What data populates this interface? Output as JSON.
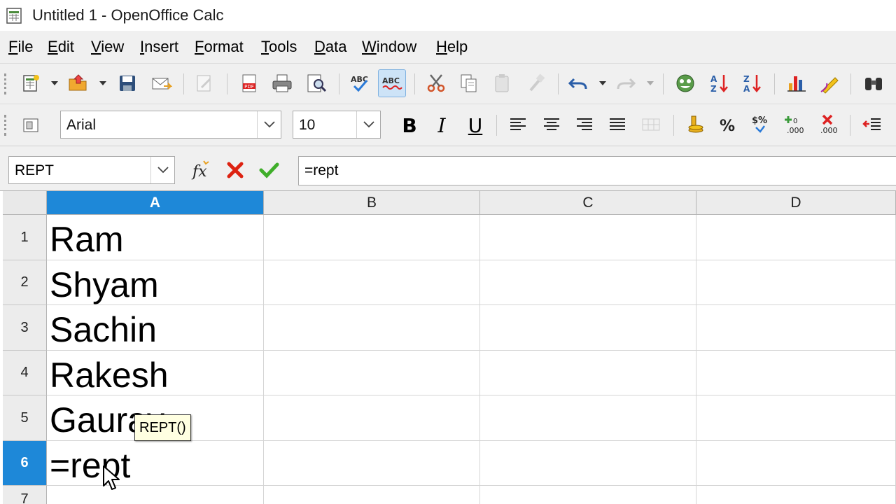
{
  "window": {
    "title": "Untitled 1 - OpenOffice Calc"
  },
  "menu": [
    {
      "label": "File",
      "u": "F",
      "rest": "ile"
    },
    {
      "label": "Edit",
      "u": "E",
      "rest": "dit"
    },
    {
      "label": "View",
      "u": "V",
      "rest": "iew"
    },
    {
      "label": "Insert",
      "u": "I",
      "rest": "nsert"
    },
    {
      "label": "Format",
      "u": "F",
      "rest": "ormat"
    },
    {
      "label": "Tools",
      "u": "T",
      "rest": "ools"
    },
    {
      "label": "Data",
      "u": "D",
      "rest": "ata"
    },
    {
      "label": "Window",
      "u": "W",
      "rest": "indow"
    },
    {
      "label": "Help",
      "u": "H",
      "rest": "elp"
    }
  ],
  "format_toolbar": {
    "font_name": "Arial",
    "font_size": "10",
    "bold_label": "B",
    "italic_label": "I",
    "underline_label": "U"
  },
  "formula_bar": {
    "name_box": "REPT",
    "formula": "=rept"
  },
  "grid": {
    "columns": [
      "A",
      "B",
      "C",
      "D"
    ],
    "selected_column": "A",
    "rows": [
      "1",
      "2",
      "3",
      "4",
      "5",
      "6",
      "7"
    ],
    "selected_row": "6",
    "cells_a": [
      "Ram",
      "Shyam",
      "Sachin",
      "Rakesh",
      "Gaurav",
      "=rept",
      ""
    ]
  },
  "tooltip": {
    "text": "REPT()"
  },
  "colors": {
    "selection": "#1e88d8",
    "tooltip_bg": "#ffffe1"
  }
}
